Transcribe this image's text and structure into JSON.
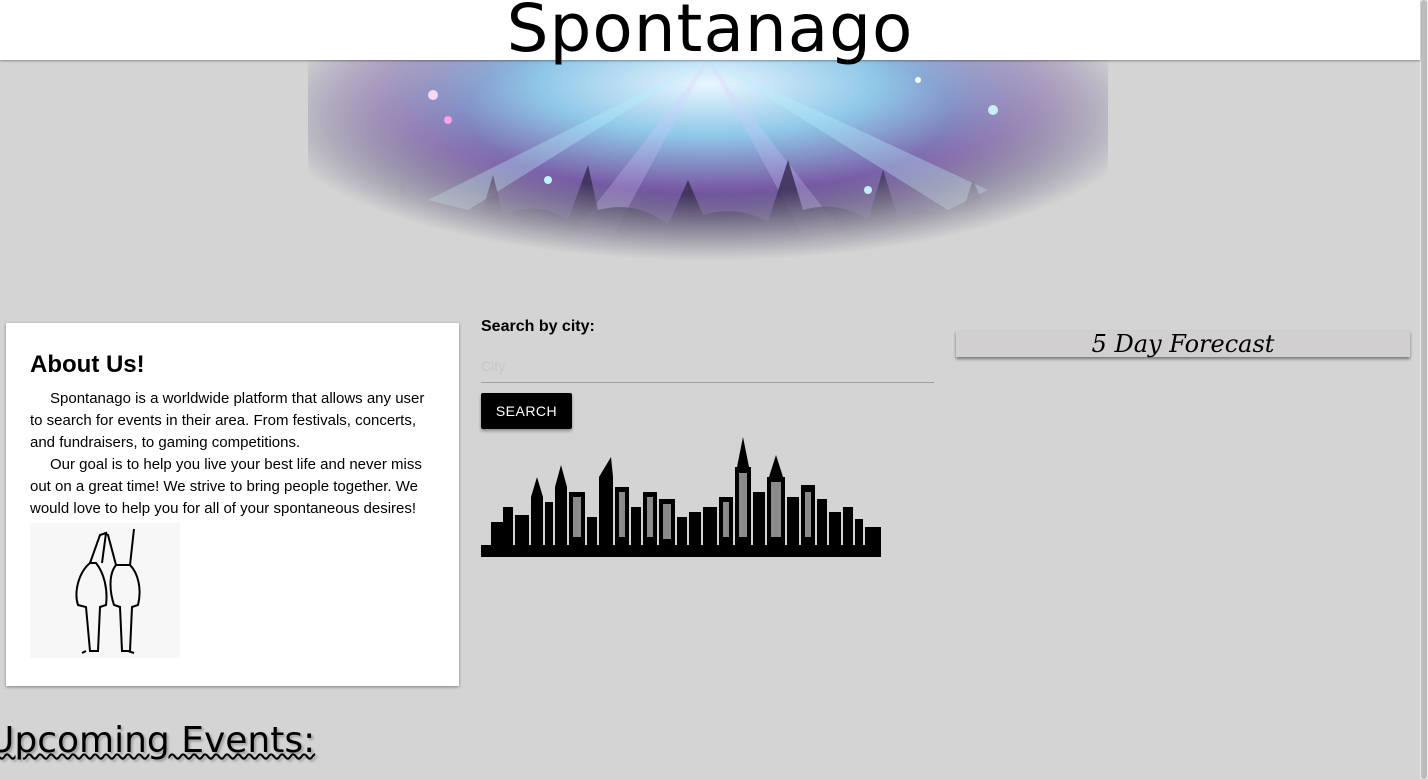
{
  "header": {
    "brand": "Spontanago"
  },
  "about": {
    "title": "About Us!",
    "paragraph1": "Spontanago is a worldwide platform that allows any user to search for events in their area. From festivals, concerts, and fundraisers, to gaming competitions.",
    "paragraph2": "Our goal is to help you live your best life and never miss out on a great time! We strive to bring people together. We would love to help you for all of your spontaneous desires!"
  },
  "search": {
    "label": "Search by city:",
    "input_value": "",
    "placeholder": "City",
    "button_label": "SEARCH"
  },
  "forecast": {
    "title": "5 Day Forecast"
  },
  "events": {
    "heading": "Upcoming Events:"
  },
  "colors": {
    "page_background": "#d4d4d4",
    "header_background": "#ffffff",
    "button_background": "#000000",
    "forecast_bar": "#d1cfcf",
    "hero_accent": "#9b7fd6"
  },
  "icons": [
    "concert-hero-image",
    "friends-illustration",
    "city-skyline-illustration"
  ]
}
